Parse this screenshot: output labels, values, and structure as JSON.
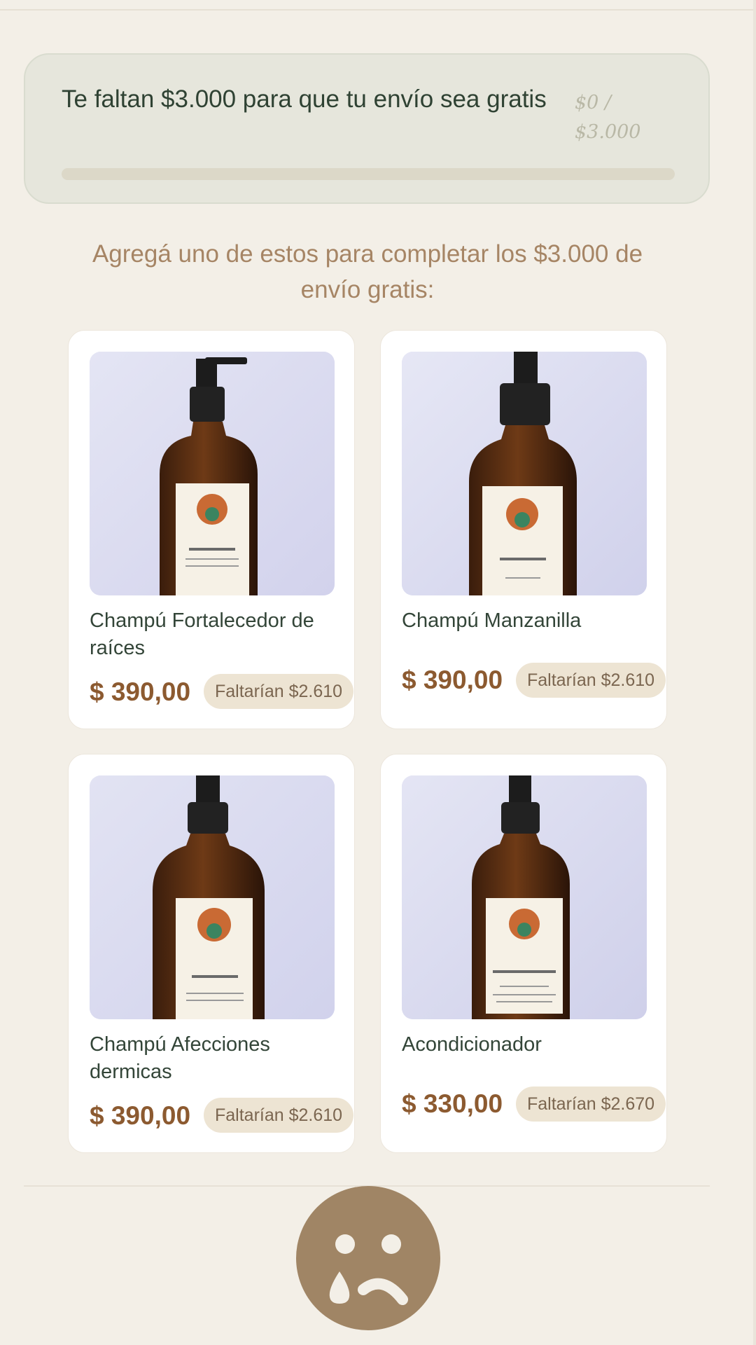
{
  "shipping": {
    "message": "Te faltan $3.000 para que tu envío sea gratis",
    "progress_text": "$0 / $3.000",
    "progress_fraction": 0,
    "accent_color": "#a08565"
  },
  "upsell": {
    "heading": "Agregá uno de estos para completar los $3.000 de envío gratis:"
  },
  "products": [
    {
      "name": "Champú Fortalecedor de raíces",
      "price": "$ 390,00",
      "remaining": "Faltarían $2.610",
      "image_icon": "shampoo-bottle-icon"
    },
    {
      "name": "Champú Manzanilla",
      "price": "$ 390,00",
      "remaining": "Faltarían $2.610",
      "image_icon": "shampoo-bottle-icon"
    },
    {
      "name": "Champú Afecciones dermicas",
      "price": "$ 390,00",
      "remaining": "Faltarían $2.610",
      "image_icon": "shampoo-bottle-icon"
    },
    {
      "name": "Acondicionador",
      "price": "$ 330,00",
      "remaining": "Faltarían $2.670",
      "image_icon": "conditioner-bottle-icon"
    }
  ],
  "empty_state": {
    "icon": "sad-face-icon"
  }
}
